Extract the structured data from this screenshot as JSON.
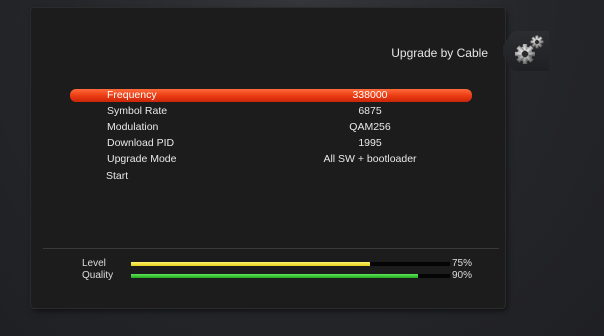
{
  "menu": {
    "title": "Upgrade by Cable",
    "rows": [
      {
        "label": "Frequency",
        "value": "338000",
        "selected": true
      },
      {
        "label": "Symbol Rate",
        "value": "6875"
      },
      {
        "label": "Modulation",
        "value": "QAM256"
      },
      {
        "label": "Download PID",
        "value": "1995"
      },
      {
        "label": "Upgrade Mode",
        "value": "All SW + bootloader"
      },
      {
        "label": "Start",
        "value": ""
      }
    ]
  },
  "signal": {
    "level_label": "Level",
    "level_percent": 75,
    "level_text": "75%",
    "quality_label": "Quality",
    "quality_percent": 90,
    "quality_text": "90%"
  },
  "icons": {
    "settings": "gears-icon"
  },
  "colors": {
    "selected_row": "#ea3a12",
    "level_bar": "#f0dd2a",
    "quality_bar": "#2fbf28"
  }
}
